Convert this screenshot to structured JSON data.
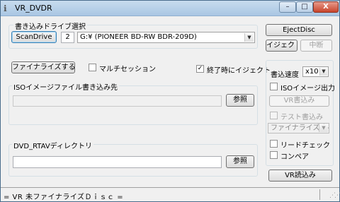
{
  "window": {
    "title": "VR_DVDR",
    "min_glyph": "–",
    "max_glyph": "□",
    "close_glyph": "X"
  },
  "drive_group": {
    "label": "書き込みドライブ選択",
    "scan_button": "ScanDrive",
    "drive_number": "2",
    "drive_select": "G:¥ (PIONEER  BD-RW   BDR-209D)"
  },
  "tray": {
    "eject_disc_button": "EjectDisc",
    "eject_button": "イジェクト",
    "stop_button": "中断"
  },
  "options": {
    "finalize_button": "ファイナライズする",
    "multisession_label": "マルチセッション",
    "multisession_checked": false,
    "eject_after_label": "終了時にイジェクト",
    "eject_after_checked": true
  },
  "iso_group": {
    "label": "ISOイメージファイル書き込み先",
    "path_value": "",
    "browse_button": "参照"
  },
  "dir_group": {
    "label": "DVD_RTAVディレクトリ",
    "path_value": "",
    "browse_button": "参照"
  },
  "side": {
    "speed_label": "書込速度",
    "speed_value": "x10",
    "iso_output_label": "ISOイメージ出力",
    "iso_output_checked": false,
    "vr_write_button": "VR書込み",
    "test_write_label": "テスト書込み",
    "test_write_checked": false,
    "finalize_select": "ファイナライズする",
    "read_check_label": "リードチェック",
    "read_check_checked": false,
    "compare_label": "コンペア",
    "compare_checked": false,
    "vr_read_button": "VR読込み"
  },
  "status": {
    "text": "= VR 未ファイナライズＤｉｓｃ ="
  },
  "icons": {
    "app": "disc-app-icon",
    "check_glyph": "✓",
    "arrow_glyph": "▼"
  }
}
